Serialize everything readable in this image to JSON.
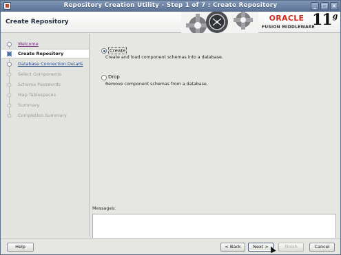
{
  "window": {
    "title": "Repository Creation Utility - Step 1 of 7 : Create Repository",
    "controls": [
      "_",
      "□",
      "×"
    ]
  },
  "header": {
    "page_title": "Create Repository",
    "logo": {
      "brand": "ORACLE",
      "product": "FUSION MIDDLEWARE",
      "version": "11",
      "version_suffix": "g"
    }
  },
  "steps": [
    {
      "label": "Welcome",
      "state": "visited"
    },
    {
      "label": "Create Repository",
      "state": "current"
    },
    {
      "label": "Database Connection Details",
      "state": "next"
    },
    {
      "label": "Select Components",
      "state": "disabled"
    },
    {
      "label": "Schema Passwords",
      "state": "disabled"
    },
    {
      "label": "Map Tablespaces",
      "state": "disabled"
    },
    {
      "label": "Summary",
      "state": "disabled"
    },
    {
      "label": "Completion Summary",
      "state": "disabled"
    }
  ],
  "options": {
    "create": {
      "label": "Create",
      "description": "Create and load component schemas into a database.",
      "selected": true
    },
    "drop": {
      "label": "Drop",
      "description": "Remove component schemas from a database.",
      "selected": false
    }
  },
  "messages": {
    "label": "Messages:",
    "text": ""
  },
  "buttons": {
    "help": "Help",
    "back": "< Back",
    "next": "Next >",
    "finish": "Finish",
    "cancel": "Cancel"
  },
  "icons": [
    "app-icon",
    "minimize-icon",
    "maximize-icon",
    "close-icon",
    "gears-graphic",
    "step-marker-icon",
    "mouse-cursor"
  ]
}
